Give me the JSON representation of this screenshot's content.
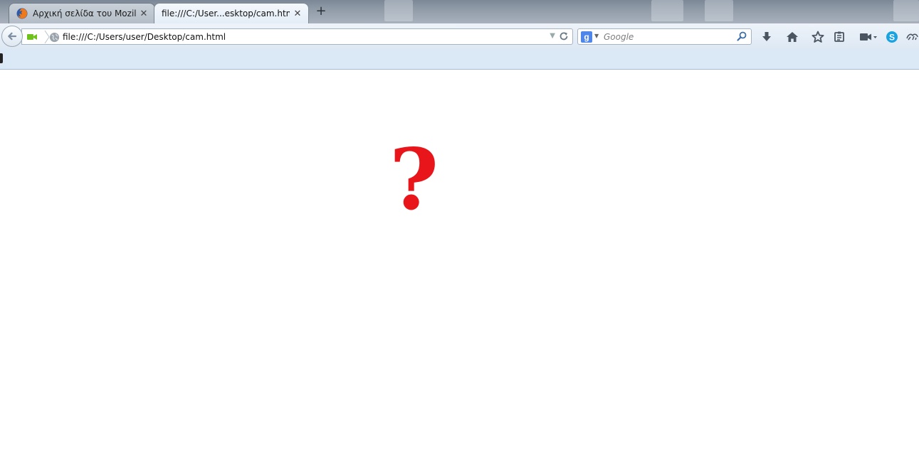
{
  "tabs": [
    {
      "label": "Αρχική σελίδα του Mozilla ...",
      "close": "✕",
      "icon": "firefox-icon",
      "active": false
    },
    {
      "label": "file:///C:/User...esktop/cam.html",
      "close": "✕",
      "active": true
    }
  ],
  "new_tab_label": "+",
  "urlbar": {
    "value": "file:///C:/Users/user/Desktop/cam.html",
    "identity_icon": "globe-icon",
    "camera_icon": "camera-icon"
  },
  "search": {
    "placeholder": "Google",
    "engine_letter": "g"
  },
  "toolbar_icons": [
    "download-icon",
    "home-icon",
    "bookmark-star-icon",
    "reading-list-icon",
    "video-camera-icon",
    "skype-icon",
    "extension-icon"
  ],
  "content": {
    "symbol": "?"
  },
  "colors": {
    "accent": "#e8151b",
    "toolbar": "#dde8f4",
    "camera_green": "#6fc21c"
  }
}
